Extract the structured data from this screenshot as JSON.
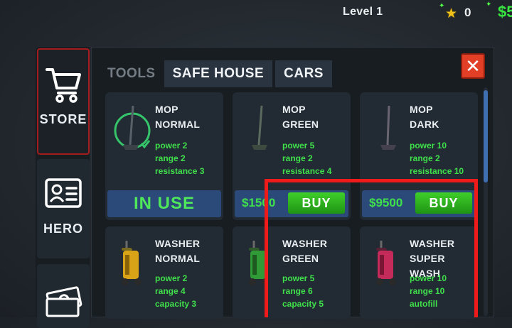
{
  "hud": {
    "level": "Level 1",
    "stars": "0",
    "money": "$5"
  },
  "sidebar": {
    "store_label": "STORE",
    "hero_label": "HERO"
  },
  "tabs": [
    {
      "label": "TOOLS",
      "active": false
    },
    {
      "label": "SAFE HOUSE",
      "active": true
    },
    {
      "label": "CARS",
      "active": true
    }
  ],
  "close_label": "✕",
  "items": [
    {
      "title1": "MOP",
      "title2": "NORMAL",
      "stats": [
        "power 2",
        "range 2",
        "resistance 3"
      ],
      "action": "IN USE"
    },
    {
      "title1": "MOP",
      "title2": "GREEN",
      "stats": [
        "power 5",
        "range 2",
        "resistance 4"
      ],
      "price": "$1500",
      "buy": "BUY"
    },
    {
      "title1": "MOP",
      "title2": "DARK",
      "stats": [
        "power 10",
        "range 2",
        "resistance 10"
      ],
      "price": "$9500",
      "buy": "BUY"
    },
    {
      "title1": "WASHER",
      "title2": "NORMAL",
      "stats": [
        "power 2",
        "range 4",
        "capacity 3"
      ]
    },
    {
      "title1": "WASHER",
      "title2": "GREEN",
      "stats": [
        "power 5",
        "range 6",
        "capacity 5"
      ]
    },
    {
      "title1": "WASHER",
      "title2": "SUPER WASH",
      "stats": [
        "power 10",
        "range 10",
        "autofill"
      ]
    }
  ],
  "colors": {
    "accent_green": "#3fe04b",
    "highlight_red": "#ef1a1a",
    "close_red": "#e24026",
    "tab_blue": "#2b4a7a"
  }
}
